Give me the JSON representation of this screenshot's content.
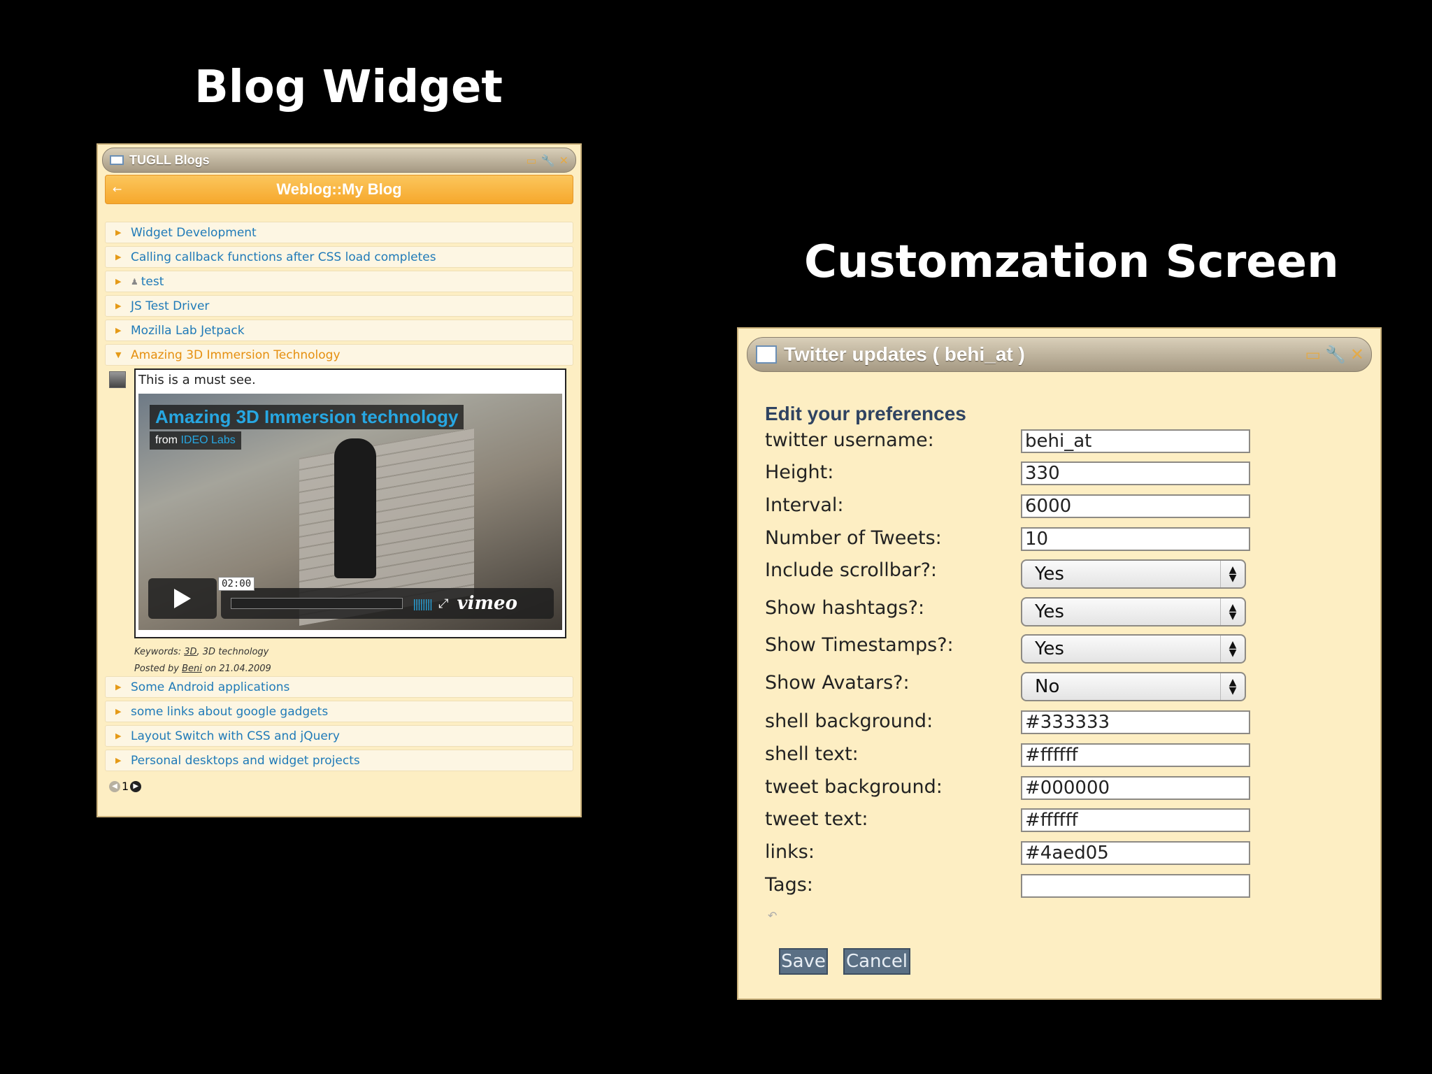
{
  "slide": {
    "left_title": "Blog Widget",
    "right_title": "Customzation Screen"
  },
  "blog_widget": {
    "window_title": "TUGLL Blogs",
    "header_title": "Weblog::My Blog",
    "posts_before": [
      {
        "title": "Widget Development"
      },
      {
        "title": "Calling callback functions after CSS load completes"
      },
      {
        "title": "test",
        "icon": "person-icon"
      },
      {
        "title": "JS Test Driver"
      },
      {
        "title": "Mozilla Lab Jetpack"
      }
    ],
    "open_post": {
      "title": "Amazing 3D Immersion Technology",
      "excerpt": "This is a must see.",
      "video": {
        "title": "Amazing 3D Immersion technology",
        "from_label": "from",
        "source": "IDEO Labs",
        "timecode": "02:00",
        "logo": "vimeo"
      },
      "keywords_label": "Keywords:",
      "keyword_1": "3D",
      "keyword_rest": ", 3D technology",
      "posted_by_label": "Posted by",
      "author": "Beni",
      "posted_on": "on 21.04.2009"
    },
    "posts_after": [
      {
        "title": "Some Android applications"
      },
      {
        "title": "some links about google gadgets"
      },
      {
        "title": "Layout Switch with CSS and jQuery"
      },
      {
        "title": "Personal desktops and widget projects"
      }
    ],
    "pager": {
      "page": "1"
    }
  },
  "custom_widget": {
    "window_title": "Twitter updates ( behi_at )",
    "heading": "Edit your preferences",
    "fields": {
      "username": {
        "label": "twitter username:",
        "value": "behi_at"
      },
      "height": {
        "label": "Height:",
        "value": "330"
      },
      "interval": {
        "label": "Interval:",
        "value": "6000"
      },
      "tweets": {
        "label": "Number of Tweets:",
        "value": "10"
      },
      "scrollbar": {
        "label": "Include scrollbar?:",
        "value": "Yes"
      },
      "hashtags": {
        "label": "Show hashtags?:",
        "value": "Yes"
      },
      "timestamps": {
        "label": "Show Timestamps?:",
        "value": "Yes"
      },
      "avatars": {
        "label": "Show Avatars?:",
        "value": "No"
      },
      "shell_bg": {
        "label": "shell background:",
        "value": "#333333"
      },
      "shell_text": {
        "label": "shell text:",
        "value": "#ffffff"
      },
      "tweet_bg": {
        "label": "tweet background:",
        "value": "#000000"
      },
      "tweet_text": {
        "label": "tweet text:",
        "value": "#ffffff"
      },
      "links": {
        "label": "links:",
        "value": "#4aed05"
      },
      "tags": {
        "label": "Tags:",
        "value": ""
      }
    },
    "save_label": "Save",
    "cancel_label": "Cancel"
  },
  "colors": {
    "background": "#000000",
    "panel": "#fdeec3",
    "link": "#1f7ab8",
    "active": "#e58f0f",
    "accent_header": "#f6a82c",
    "button": "#5a6f84"
  }
}
